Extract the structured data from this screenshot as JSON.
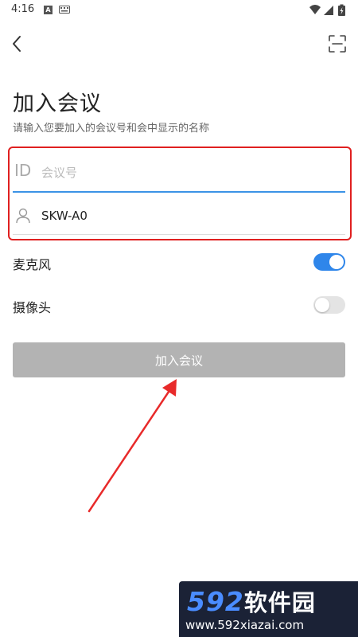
{
  "status_bar": {
    "time": "4:16",
    "notification_badge": "A",
    "icons": [
      "keyboard-icon",
      "wifi-icon",
      "cell-signal-icon",
      "battery-icon"
    ]
  },
  "nav": {
    "back_icon": "chevron-left-icon",
    "scan_icon": "scan-icon"
  },
  "page": {
    "title": "加入会议",
    "subtitle": "请输入您要加入的会议号和会中显示的名称"
  },
  "form": {
    "meeting_id": {
      "icon_text": "ID",
      "placeholder": "会议号",
      "value": ""
    },
    "display_name": {
      "icon": "person-icon",
      "value": "SKW-A0"
    }
  },
  "toggles": {
    "microphone": {
      "label": "麦克风",
      "enabled": true
    },
    "camera": {
      "label": "摄像头",
      "enabled": false
    }
  },
  "join_button": {
    "label": "加入会议",
    "enabled": false
  },
  "annotation": {
    "highlight_color": "#e02020",
    "arrow_color": "#e82a2a"
  },
  "colors": {
    "accent": "#2f86ea",
    "button_disabled": "#b3b3b3"
  },
  "watermark": {
    "number": "592",
    "brand_cn": "软件园",
    "url": "www.592xiazai.com"
  }
}
